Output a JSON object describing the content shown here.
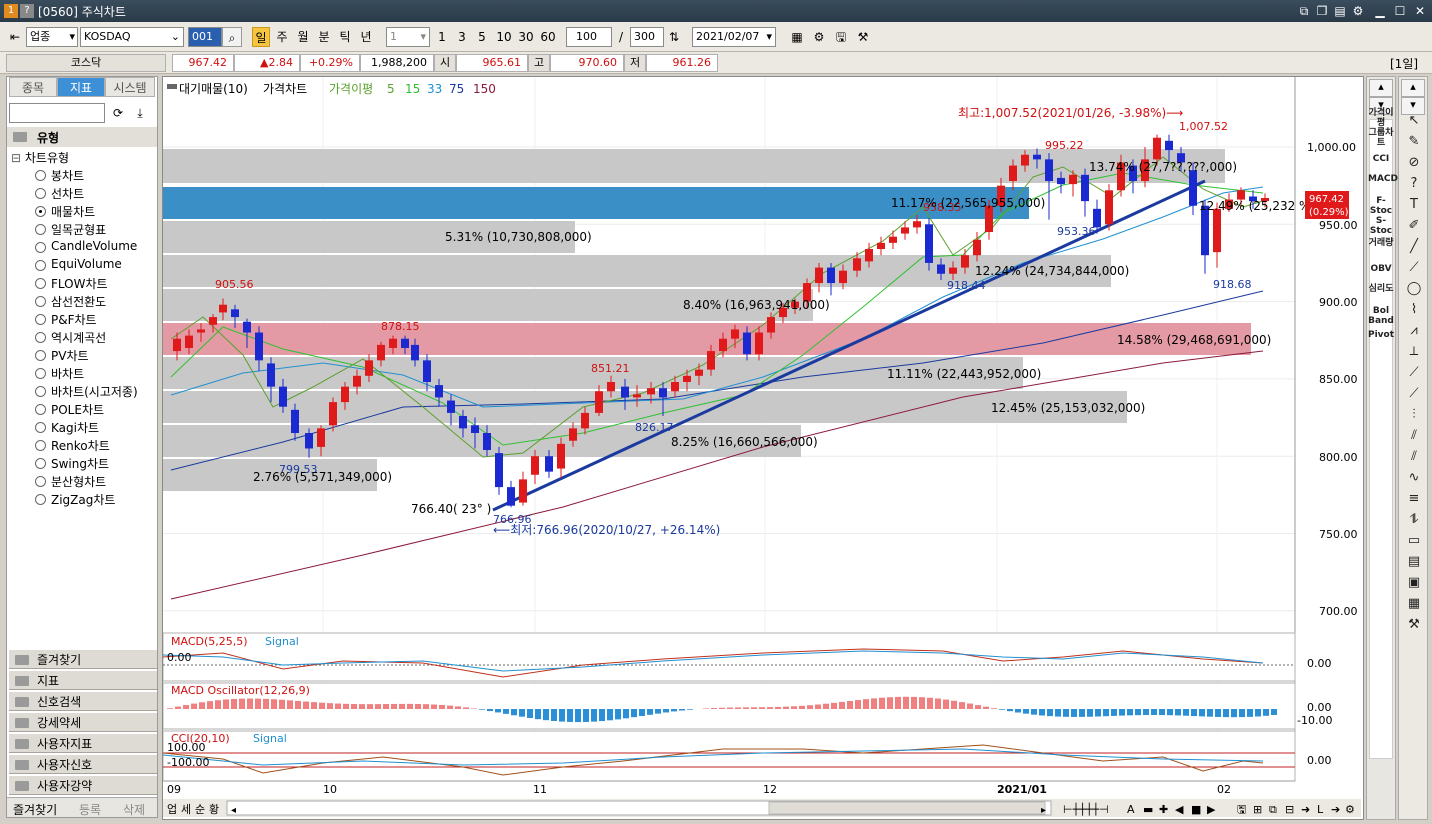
{
  "window": {
    "title": "[0560] 주식차트",
    "icons": [
      "1",
      "?"
    ]
  },
  "toolbar": {
    "market_type": "업종",
    "market": "KOSDAQ",
    "code": "001",
    "periods": [
      "일",
      "주",
      "월",
      "분",
      "틱",
      "년"
    ],
    "selected_period": "일",
    "interval_value": "1",
    "quick_intervals": [
      "1",
      "3",
      "5",
      "10",
      "30",
      "60"
    ],
    "count": "100",
    "divider": "/",
    "total": "300",
    "date": "2021/02/07"
  },
  "quote": {
    "name": "코스닥",
    "price": "967.42",
    "change": "▲2.84",
    "change_pct": "+0.29%",
    "volume": "1,988,200",
    "open_label": "시",
    "open": "965.61",
    "high_label": "고",
    "high": "970.60",
    "low_label": "저",
    "low": "961.26",
    "period_badge": "[1일]"
  },
  "left_panel": {
    "tabs": [
      "종목",
      "지표",
      "시스템"
    ],
    "active_tab": "지표",
    "section_title": "유형",
    "group_title": "차트유형",
    "chart_types": [
      "봉차트",
      "선차트",
      "매물차트",
      "일목균형표",
      "CandleVolume",
      "EquiVolume",
      "FLOW차트",
      "삼선전환도",
      "P&F차트",
      "역시계곡선",
      "PV차트",
      "바차트",
      "바차트(시고저종)",
      "POLE차트",
      "Kagi차트",
      "Renko차트",
      "Swing차트",
      "분산형차트",
      "ZigZag차트"
    ],
    "selected_type": "매물차트",
    "bottom_items": [
      "즐겨찾기",
      "지표",
      "신호검색",
      "강세약세",
      "사용자지표",
      "사용자신호",
      "사용자강약"
    ],
    "footer_tabs": [
      "즐겨찾기",
      "등록",
      "삭제"
    ]
  },
  "chart": {
    "legend": {
      "volume_profile": "대기매물(10)",
      "price": "가격차트",
      "ma_label": "가격이평",
      "ma_periods": [
        "5",
        "15",
        "33",
        "75",
        "150"
      ],
      "ma_colors": [
        "#5aa02c",
        "#30c030",
        "#2090d0",
        "#1a3aa0",
        "#8b1a3a"
      ]
    },
    "high_note": "최고:1,007.52(2021/01/26, -3.98%)⟶",
    "low_note": "⟵최저:766.96(2020/10/27, +26.14%)",
    "trend_label": "766.40( 23° )",
    "price_labels": [
      "905.56",
      "878.15",
      "799.53",
      "766.96",
      "851.21",
      "826.17",
      "958.35",
      "918.44",
      "995.22",
      "953.36",
      "1,007.52",
      "918.68"
    ],
    "volume_profile_labels": [
      "13.74% (27,7??,???,000)",
      "11.17% (22,565,955,000)",
      "5.31% (10,730,808,000)",
      "12.24% (24,734,844,000)",
      "8.40% (16,963,941,000)",
      "14.58% (29,468,691,000)",
      "11.11% (22,443,952,000)",
      "12.45% (25,153,032,000)",
      "8.25% (16,660,566,000)",
      "2.76% (5,571,349,000)",
      "12.49% (25,232 %)"
    ],
    "y_axis": [
      "1,000.00",
      "950.00",
      "900.00",
      "850.00",
      "800.00",
      "750.00",
      "700.00"
    ],
    "current_price_tag": "967.42",
    "current_pct_tag": "(0.29%)",
    "x_axis": [
      "09",
      "10",
      "11",
      "12",
      "2021/01",
      "02"
    ],
    "macd": {
      "title": "MACD(5,25,5)",
      "signal": "Signal",
      "zero_left": "0.00",
      "zero_right": "0.00"
    },
    "osc": {
      "title": "MACD Oscillator(12,26,9)",
      "r1": "0.00",
      "r2": "-10.00"
    },
    "cci": {
      "title": "CCI(20,10)",
      "signal": "Signal",
      "l1": "100.00",
      "l2": "-100.00",
      "r1": "0.00"
    },
    "bottom_buttons": [
      "업",
      "세",
      "순",
      "황"
    ]
  },
  "right_labels": [
    "가격이평",
    "그룹차트",
    "CCI",
    "MACD",
    "F-Stoc",
    "S-Stoc",
    "거래량",
    "OBV",
    "심리도",
    "Bol Band",
    "Pivot"
  ]
}
